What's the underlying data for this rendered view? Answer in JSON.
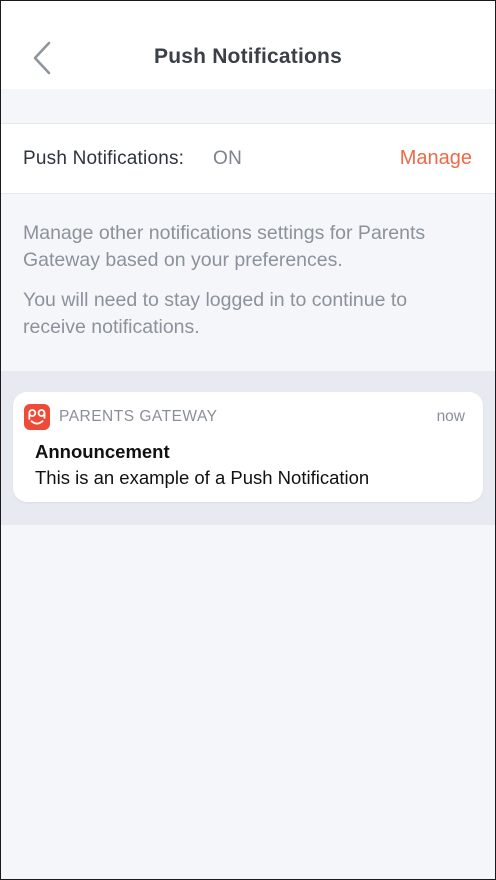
{
  "header": {
    "title": "Push Notifications",
    "back_icon": "chevron-left-icon"
  },
  "setting": {
    "label": "Push Notifications:",
    "status": "ON",
    "action_label": "Manage"
  },
  "description": {
    "paragraph_1": "Manage other notifications settings for Parents Gateway based on your preferences.",
    "paragraph_2": "You will need to stay logged in to continue to receive notifications."
  },
  "preview": {
    "app_name": "PARENTS GATEWAY",
    "app_icon": "parents-gateway-app-icon",
    "time": "now",
    "title": "Announcement",
    "body": "This is an example of a Push Notification"
  },
  "colors": {
    "accent": "#ec6a48",
    "app_icon": "#ef4a37",
    "background": "#f4f6f9",
    "preview_band": "#e7eaf1"
  }
}
